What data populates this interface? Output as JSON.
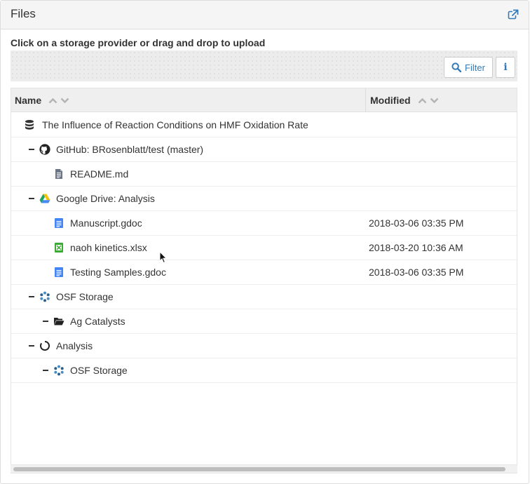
{
  "panel": {
    "title": "Files",
    "upload_hint": "Click on a storage provider or drag and drop to upload"
  },
  "toolbar": {
    "filter_label": "Filter",
    "info_label": "i"
  },
  "columns": {
    "name": "Name",
    "modified": "Modified"
  },
  "rows": [
    {
      "label": "The Influence of Reaction Conditions on HMF Oxidation Rate",
      "modified": "",
      "icon": "database-icon",
      "depth": 0,
      "toggle": false
    },
    {
      "label": "GitHub: BRosenblatt/test (master)",
      "modified": "",
      "icon": "github-icon",
      "depth": 1,
      "toggle": true
    },
    {
      "label": "README.md",
      "modified": "",
      "icon": "text-file-icon",
      "depth": 2,
      "toggle": false
    },
    {
      "label": "Google Drive: Analysis",
      "modified": "",
      "icon": "google-drive-icon",
      "depth": 1,
      "toggle": true
    },
    {
      "label": "Manuscript.gdoc",
      "modified": "2018-03-06 03:35 PM",
      "icon": "google-doc-icon",
      "depth": 2,
      "toggle": false
    },
    {
      "label": "naoh kinetics.xlsx",
      "modified": "2018-03-20 10:36 AM",
      "icon": "spreadsheet-icon",
      "depth": 2,
      "toggle": false
    },
    {
      "label": "Testing Samples.gdoc",
      "modified": "2018-03-06 03:35 PM",
      "icon": "google-doc-icon",
      "depth": 2,
      "toggle": false
    },
    {
      "label": "OSF Storage",
      "modified": "",
      "icon": "osf-storage-icon",
      "depth": 1,
      "toggle": true
    },
    {
      "label": "Ag Catalysts",
      "modified": "",
      "icon": "folder-open-icon",
      "depth": 2,
      "toggle": true
    },
    {
      "label": "Analysis",
      "modified": "",
      "icon": "component-circle-icon",
      "depth": 1,
      "toggle": true
    },
    {
      "label": "OSF Storage",
      "modified": "",
      "icon": "osf-storage-icon",
      "depth": 2,
      "toggle": true
    }
  ],
  "colors": {
    "link_blue": "#337ab7",
    "doc_blue": "#4285f4",
    "sheet_green": "#3aaa35",
    "osf_blue": "#4a8fc4"
  }
}
